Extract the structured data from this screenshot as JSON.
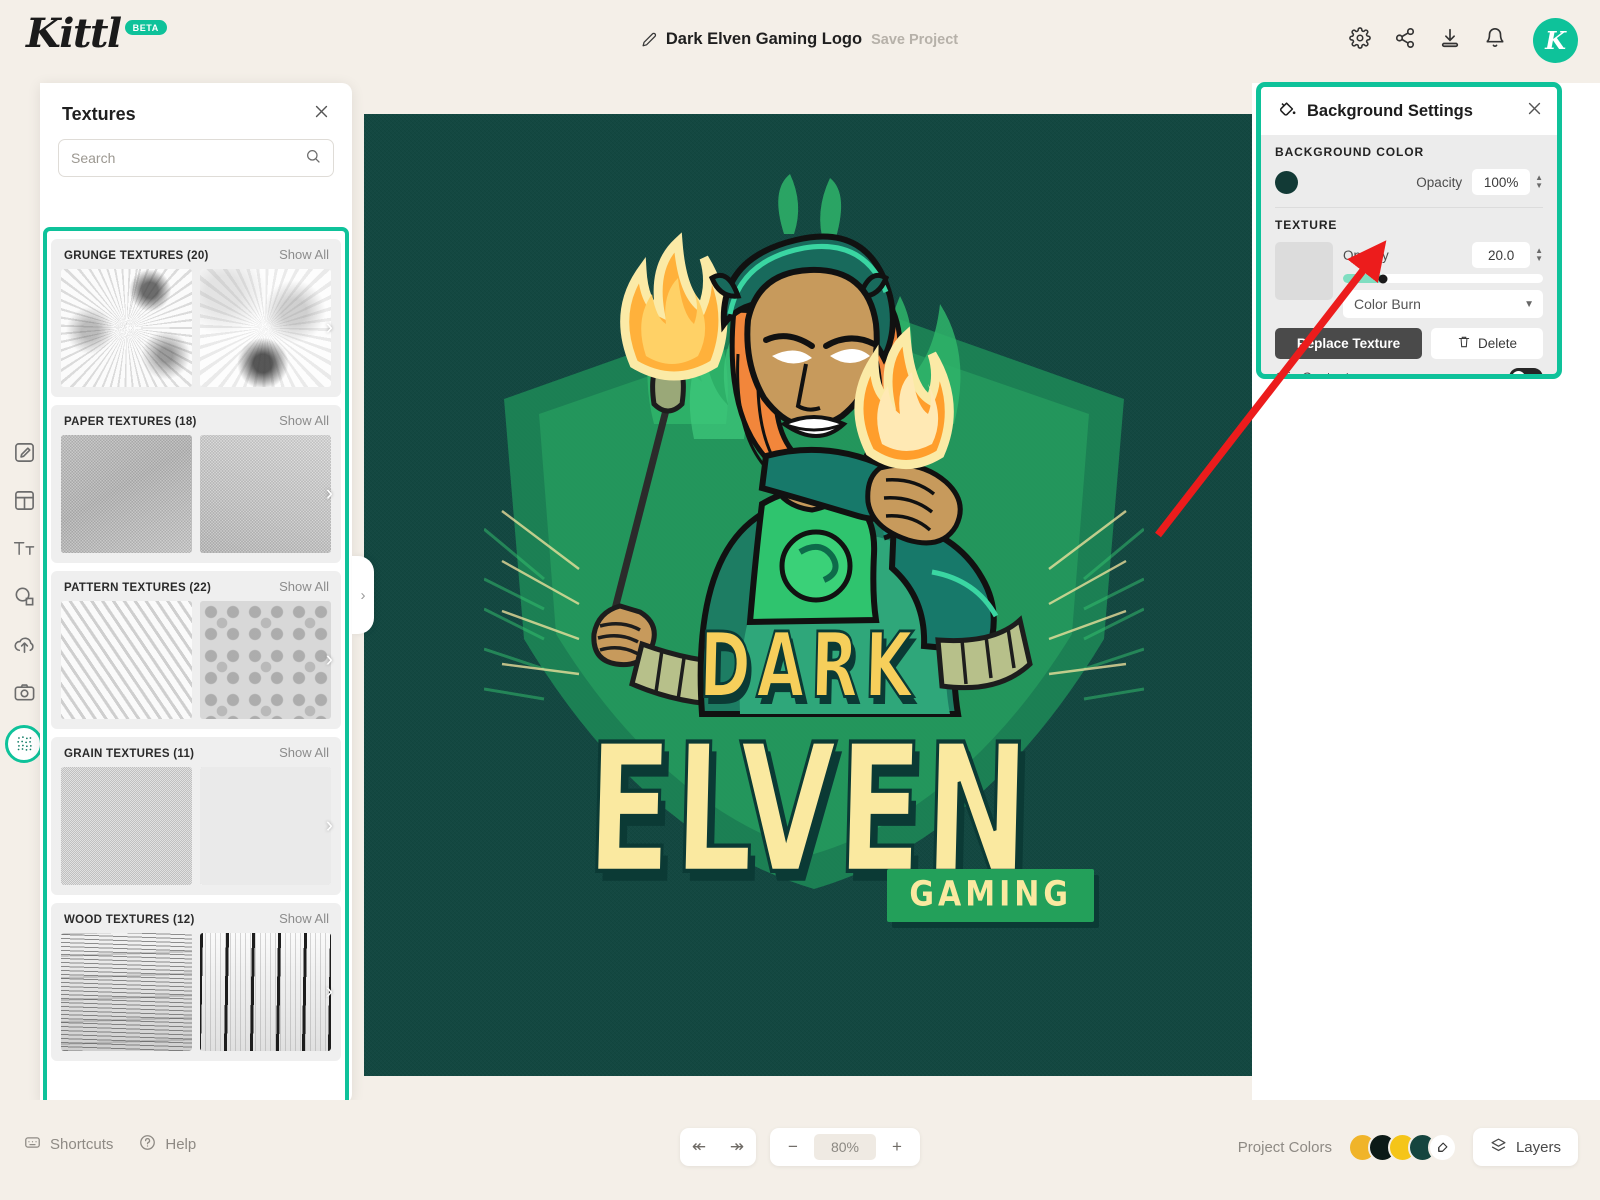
{
  "app": {
    "brand": "Kittl",
    "brand_badge": "BETA",
    "project_title": "Dark Elven Gaming Logo",
    "save_label": "Save Project",
    "avatar_letter": "K",
    "accent_color": "#0ec29a",
    "canvas_bg_color": "#10463f"
  },
  "top_icons": [
    {
      "name": "settings-icon",
      "label": "Settings"
    },
    {
      "name": "share-icon",
      "label": "Share"
    },
    {
      "name": "download-icon",
      "label": "Download"
    },
    {
      "name": "notifications-icon",
      "label": "Notifications"
    }
  ],
  "rail": [
    {
      "name": "design-icon",
      "label": "Design"
    },
    {
      "name": "templates-icon",
      "label": "Templates"
    },
    {
      "name": "text-icon",
      "label": "Text"
    },
    {
      "name": "elements-icon",
      "label": "Elements"
    },
    {
      "name": "uploads-icon",
      "label": "Uploads"
    },
    {
      "name": "photos-icon",
      "label": "Photos"
    },
    {
      "name": "textures-icon",
      "label": "Textures"
    }
  ],
  "left_panel": {
    "title": "Textures",
    "close_label": "×",
    "search": {
      "placeholder": "Search",
      "value": ""
    },
    "show_all_label": "Show All",
    "categories": [
      {
        "name": "GRUNGE TEXTURES (20)",
        "thumbs": [
          "tx-grunge1",
          "tx-grunge2"
        ]
      },
      {
        "name": "PAPER TEXTURES (18)",
        "thumbs": [
          "tx-paper1",
          "tx-paper2"
        ]
      },
      {
        "name": "PATTERN TEXTURES (22)",
        "thumbs": [
          "tx-pattern1",
          "tx-pattern2"
        ]
      },
      {
        "name": "GRAIN TEXTURES (11)",
        "thumbs": [
          "tx-grain1",
          "tx-grain2"
        ]
      },
      {
        "name": "WOOD TEXTURES (12)",
        "thumbs": [
          "tx-wood1",
          "tx-wood2"
        ]
      }
    ]
  },
  "canvas": {
    "wordmark_top": "DARK",
    "wordmark_main": "ELVEN",
    "badge_text": "GAMING"
  },
  "background_settings": {
    "title": "Background Settings",
    "icon": "paint-bucket-icon",
    "close_label": "×",
    "background_color_label": "BACKGROUND COLOR",
    "background_color_value": "#123a36",
    "bg_opacity_label": "Opacity",
    "bg_opacity_value": "100%",
    "texture_label": "TEXTURE",
    "texture_opacity_label": "Opacity",
    "texture_opacity_value": "20.0",
    "texture_opacity_percent": 20,
    "blend_mode": "Color Burn",
    "replace_texture_label": "Replace Texture",
    "delete_label": "Delete",
    "clip_content_label": "Clip Content",
    "clip_content_on": true
  },
  "bottom_bar": {
    "shortcuts_label": "Shortcuts",
    "help_label": "Help",
    "undo_label": "↞",
    "redo_label": "↠",
    "zoom_out_label": "−",
    "zoom_value": "80%",
    "zoom_in_label": "+",
    "project_colors_label": "Project Colors",
    "project_colors": [
      "#f0b429",
      "#0c1a17",
      "#f5c518",
      "#15453f"
    ],
    "layers_label": "Layers"
  }
}
